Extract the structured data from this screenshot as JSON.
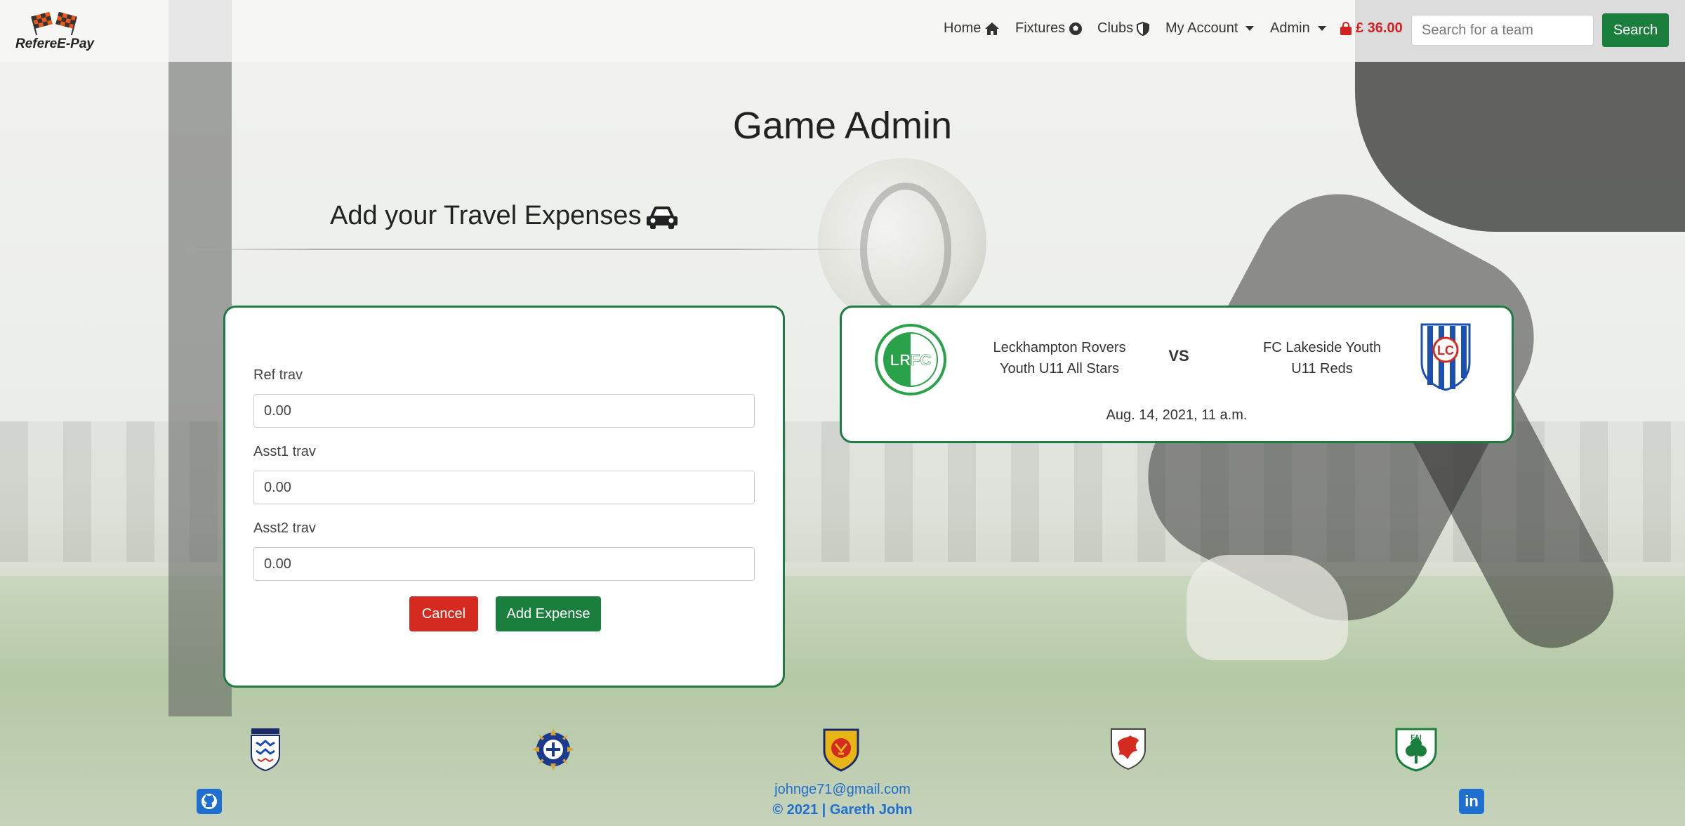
{
  "brand": {
    "name": "RefereE-Pay",
    "logo_icon": "checkered-flags-icon"
  },
  "nav": {
    "items": [
      {
        "label": "Home",
        "icon": "home-icon"
      },
      {
        "label": "Fixtures",
        "icon": "football-icon"
      },
      {
        "label": "Clubs",
        "icon": "shield-icon"
      },
      {
        "label": "My Account",
        "icon": "caret-down-icon"
      },
      {
        "label": "Admin",
        "icon": "caret-down-icon"
      }
    ],
    "basket": {
      "amount": "£ 36.00",
      "icon": "shopping-bag-icon",
      "color": "#d32020"
    },
    "search": {
      "placeholder": "Search for a team",
      "button_label": "Search"
    }
  },
  "page": {
    "title": "Game Admin",
    "section_title": "Add your Travel Expenses",
    "section_icon": "car-icon"
  },
  "form": {
    "fields": [
      {
        "label": "Ref trav",
        "value": "0.00"
      },
      {
        "label": "Asst1 trav",
        "value": "0.00"
      },
      {
        "label": "Asst2 trav",
        "value": "0.00"
      }
    ],
    "cancel_label": "Cancel",
    "submit_label": "Add Expense"
  },
  "fixture": {
    "home": {
      "name_line1": "Leckhampton Rovers",
      "name_line2": "Youth U11 All Stars",
      "crest_text": "LRFC",
      "crest_color": "#2aa24a"
    },
    "vs_label": "VS",
    "away": {
      "name_line1": "FC Lakeside Youth",
      "name_line2": "U11 Reds",
      "crest_text": "LC",
      "crest_colors": [
        "#1b4fb3",
        "#d42a1f"
      ]
    },
    "kickoff": "Aug. 14, 2021, 11 a.m."
  },
  "footer": {
    "badges": [
      "england-fa-badge",
      "northern-ireland-fa-badge",
      "scotland-fa-badge",
      "wales-fa-badge",
      "ireland-fai-badge"
    ],
    "email": "johnge71@gmail.com",
    "copyright": "© 2021 | Gareth John",
    "social": [
      "github-icon",
      "linkedin-icon"
    ]
  },
  "colors": {
    "primary_green": "#1a7f3c",
    "danger_red": "#d42a1f",
    "link_blue": "#1f6fd0"
  }
}
